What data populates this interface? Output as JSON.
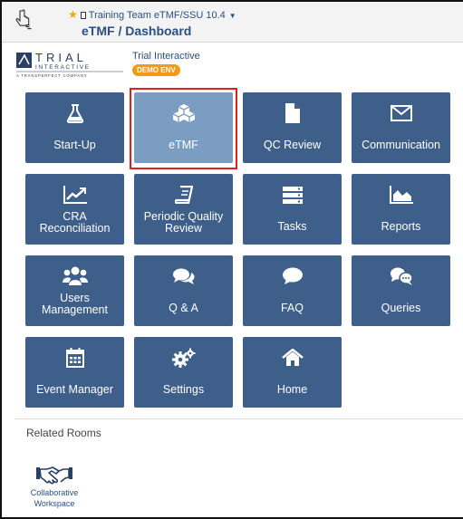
{
  "header": {
    "breadcrumb": "Training Team eTMF/SSU 10.4",
    "page_title": "eTMF / Dashboard"
  },
  "brand": {
    "logo_word": "TRIAL",
    "logo_sub": "INTERACTIVE",
    "logo_tagline": "A TRANSPERFECT COMPANY",
    "org_name": "Trial Interactive",
    "env_badge": "DEMO ENV"
  },
  "tiles": [
    {
      "id": "start-up",
      "label": "Start-Up",
      "icon": "flask-icon"
    },
    {
      "id": "etmf",
      "label": "eTMF",
      "icon": "cubes-icon",
      "selected": true
    },
    {
      "id": "qc-review",
      "label": "QC Review",
      "icon": "document-icon"
    },
    {
      "id": "communication",
      "label": "Communication",
      "icon": "envelope-icon"
    },
    {
      "id": "cra-reconciliation",
      "label": "CRA Reconciliation",
      "icon": "line-chart-icon"
    },
    {
      "id": "periodic-quality-review",
      "label": "Periodic Quality Review",
      "icon": "book-icon"
    },
    {
      "id": "tasks",
      "label": "Tasks",
      "icon": "server-icon"
    },
    {
      "id": "reports",
      "label": "Reports",
      "icon": "area-chart-icon"
    },
    {
      "id": "users-management",
      "label": "Users Management",
      "icon": "users-icon"
    },
    {
      "id": "q-and-a",
      "label": "Q & A",
      "icon": "comments-icon"
    },
    {
      "id": "faq",
      "label": "FAQ",
      "icon": "comment-icon"
    },
    {
      "id": "queries",
      "label": "Queries",
      "icon": "chat-bubbles-icon"
    },
    {
      "id": "event-manager",
      "label": "Event Manager",
      "icon": "calendar-icon"
    },
    {
      "id": "settings",
      "label": "Settings",
      "icon": "cogs-icon"
    },
    {
      "id": "home",
      "label": "Home",
      "icon": "home-icon"
    }
  ],
  "related": {
    "heading": "Related Rooms",
    "rooms": [
      {
        "label": "Collaborative Workspace",
        "icon": "handshake-icon"
      }
    ]
  },
  "colors": {
    "tile": "#3e5f8a",
    "tile_selected": "#7b9dc1",
    "highlight": "#e0201b",
    "badge": "#f39a12",
    "link": "#2a4f82"
  }
}
